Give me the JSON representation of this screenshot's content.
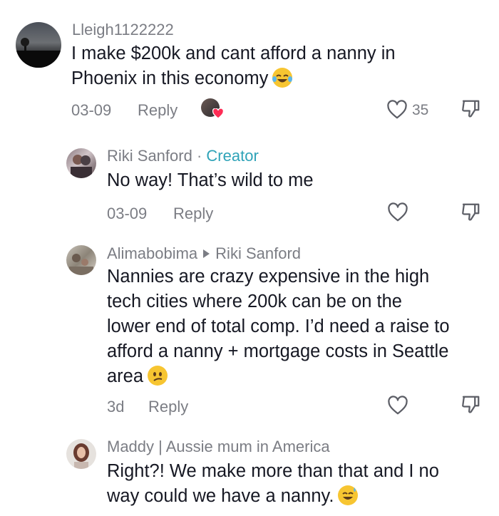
{
  "comments": [
    {
      "username": "Lleigh1122222",
      "text_line1": "I make $200k and cant afford a nanny in",
      "text_line2": "Phoenix in this economy",
      "date": "03-09",
      "reply": "Reply",
      "likes": "35",
      "emoji": "tears-of-joy-emoji"
    },
    {
      "username": "Riki Sanford",
      "separator": "·",
      "badge": "Creator",
      "text_line1": "No way! That’s wild to me",
      "date": "03-09",
      "reply": "Reply"
    },
    {
      "username": "Alimabobima",
      "reply_to": "Riki Sanford",
      "text_line1": "Nannies are crazy expensive in the high",
      "text_line2": "tech cities where 200k can be on the",
      "text_line3": "lower end of total comp. I’d need a raise to",
      "text_line4": "afford a nanny + mortgage costs in Seattle",
      "text_line5": "area",
      "date": "3d",
      "reply": "Reply",
      "emoji": "confused-face-emoji"
    },
    {
      "username": "Maddy | Aussie mum in America",
      "text_line1": "Right?! We make more than that and I no",
      "text_line2": "way could we have a nanny.",
      "emoji": "grinning-sweat-emoji"
    }
  ],
  "colors": {
    "text": "#161823",
    "meta": "#7b7d84",
    "creator": "#2fa3b8",
    "heart_red": "#fe2c55"
  }
}
